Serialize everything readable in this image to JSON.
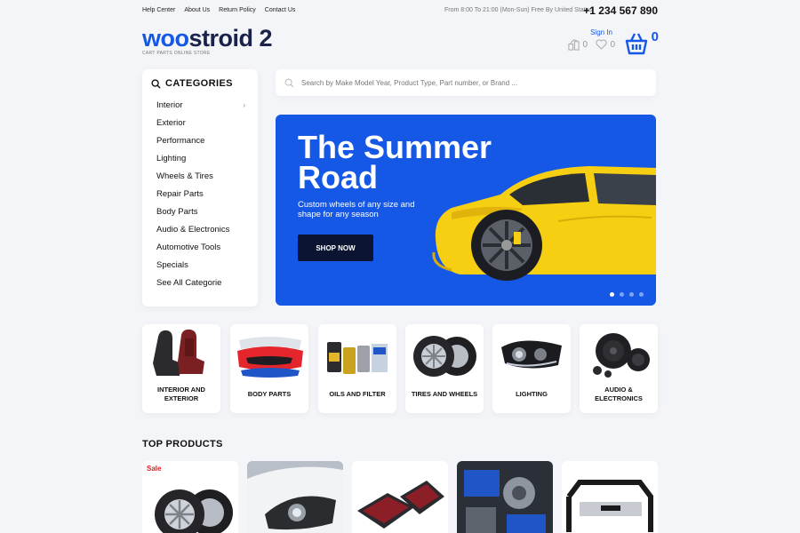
{
  "topbar": {
    "links": [
      "Help Center",
      "About Us",
      "Return Policy",
      "Contact Us"
    ],
    "hours": "From 8:00 To 21:00 (Mon-Sun) Free By United States",
    "phone": "+1 234 567 890"
  },
  "logo": {
    "woo": "woo",
    "rest": "stroid 2",
    "tagline": "CART PARTS ONLINE STORE"
  },
  "header": {
    "signin": "Sign In",
    "compare_count": "0",
    "wishlist_count": "0",
    "cart_count": "0"
  },
  "categories": {
    "title": "CATEGORIES",
    "items": [
      "Interior",
      "Exterior",
      "Performance",
      "Lighting",
      "Wheels & Tires",
      "Repair Parts",
      "Body Parts",
      "Audio & Electronics",
      "Automotive Tools",
      "Specials",
      "See All Categorie"
    ]
  },
  "search": {
    "placeholder": "Search by Make Model Year, Product Type, Part number, or Brand ..."
  },
  "hero": {
    "title": "The Summer Road",
    "subtitle": "Custom wheels of any size and shape for any season",
    "button": "SHOP NOW",
    "slides": 4,
    "active_slide": 1
  },
  "tiles": [
    "INTERIOR AND EXTERIOR",
    "BODY PARTS",
    "OILS AND FILTER",
    "TIRES AND WHEELS",
    "LIGHTING",
    "AUDIO & ELECTRONICS"
  ],
  "top_products": {
    "title": "TOP PRODUCTS",
    "sale_label": "Sale"
  },
  "colors": {
    "accent": "#1658e6",
    "dark": "#0b1531",
    "sale": "#e21b1b"
  }
}
